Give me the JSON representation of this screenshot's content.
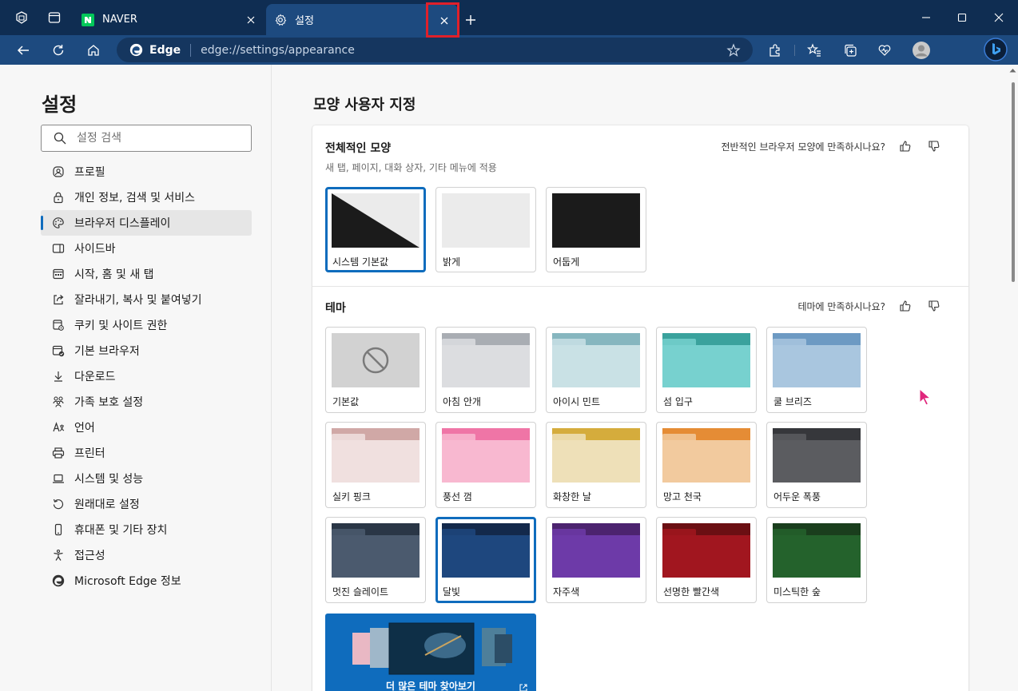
{
  "tabs": [
    {
      "title": "NAVER",
      "favicon": "naver-n-icon",
      "active": false
    },
    {
      "title": "설정",
      "favicon": "gear-icon",
      "active": true
    }
  ],
  "address": {
    "brand": "Edge",
    "url": "edge://settings/appearance"
  },
  "sidebar": {
    "title": "설정",
    "search_placeholder": "설정 검색",
    "items": [
      {
        "label": "프로필",
        "icon": "profile-icon"
      },
      {
        "label": "개인 정보, 검색 및 서비스",
        "icon": "lock-icon"
      },
      {
        "label": "브라우저 디스플레이",
        "icon": "palette-icon",
        "active": true
      },
      {
        "label": "사이드바",
        "icon": "sidebar-icon"
      },
      {
        "label": "시작, 홈 및 새 탭",
        "icon": "home-grid-icon"
      },
      {
        "label": "잘라내기, 복사 및 붙여넣기",
        "icon": "share-icon"
      },
      {
        "label": "쿠키 및 사이트 권한",
        "icon": "cookie-icon"
      },
      {
        "label": "기본 브라우저",
        "icon": "browser-check-icon"
      },
      {
        "label": "다운로드",
        "icon": "download-icon"
      },
      {
        "label": "가족 보호 설정",
        "icon": "family-icon"
      },
      {
        "label": "언어",
        "icon": "language-icon"
      },
      {
        "label": "프린터",
        "icon": "printer-icon"
      },
      {
        "label": "시스템 및 성능",
        "icon": "laptop-icon"
      },
      {
        "label": "원래대로 설정",
        "icon": "reset-icon"
      },
      {
        "label": "휴대폰 및 기타 장치",
        "icon": "phone-icon"
      },
      {
        "label": "접근성",
        "icon": "accessibility-icon"
      },
      {
        "label": "Microsoft Edge 정보",
        "icon": "edge-logo-icon"
      }
    ]
  },
  "main": {
    "title": "모양 사용자 지정",
    "overall": {
      "title": "전체적인 모양",
      "subtitle": "새 탭, 페이지, 대화 상자, 기타 메뉴에 적용",
      "feedback": "전반적인 브라우저 모양에 만족하시나요?",
      "options": [
        {
          "label": "시스템 기본값",
          "selected": true
        },
        {
          "label": "밝게",
          "selected": false
        },
        {
          "label": "어둡게",
          "selected": false
        }
      ]
    },
    "theme": {
      "title": "테마",
      "feedback": "테마에 만족하시나요?",
      "options": [
        {
          "label": "기본값",
          "top": "",
          "body": "#d2d2d2",
          "selected": false
        },
        {
          "label": "아침 안개",
          "top": "#a9adb3",
          "body": "#dcdde0",
          "selected": false
        },
        {
          "label": "아이시 민트",
          "top": "#86b6bf",
          "body": "#c9e1e5",
          "selected": false
        },
        {
          "label": "섬 입구",
          "top": "#3aa29d",
          "body": "#77d1cf",
          "selected": false
        },
        {
          "label": "쿨 브리즈",
          "top": "#6d9ac3",
          "body": "#a9c6df",
          "selected": false
        },
        {
          "label": "실키 핑크",
          "top": "#d0a8a6",
          "body": "#f0e0df",
          "selected": false
        },
        {
          "label": "풍선 껌",
          "top": "#ef75a6",
          "body": "#f8b8d0",
          "selected": false
        },
        {
          "label": "화창한 날",
          "top": "#d5ac3c",
          "body": "#eee0b8",
          "selected": false
        },
        {
          "label": "망고 천국",
          "top": "#e58c35",
          "body": "#f2ca9e",
          "selected": false
        },
        {
          "label": "어두운 폭풍",
          "top": "#36373b",
          "body": "#5b5c60",
          "selected": false
        },
        {
          "label": "멋진 슬레이트",
          "top": "#2a3646",
          "body": "#4b5a6e",
          "selected": false
        },
        {
          "label": "달빛",
          "top": "#13294b",
          "body": "#1e477e",
          "selected": true
        },
        {
          "label": "자주색",
          "top": "#4c236f",
          "body": "#6d3aa8",
          "selected": false
        },
        {
          "label": "선명한 빨간색",
          "top": "#6b0f13",
          "body": "#a1161f",
          "selected": false
        },
        {
          "label": "미스틱한 숲",
          "top": "#1a3e1d",
          "body": "#24622c",
          "selected": false
        }
      ]
    },
    "promo_label": "더 많은 테마 찾아보기"
  }
}
